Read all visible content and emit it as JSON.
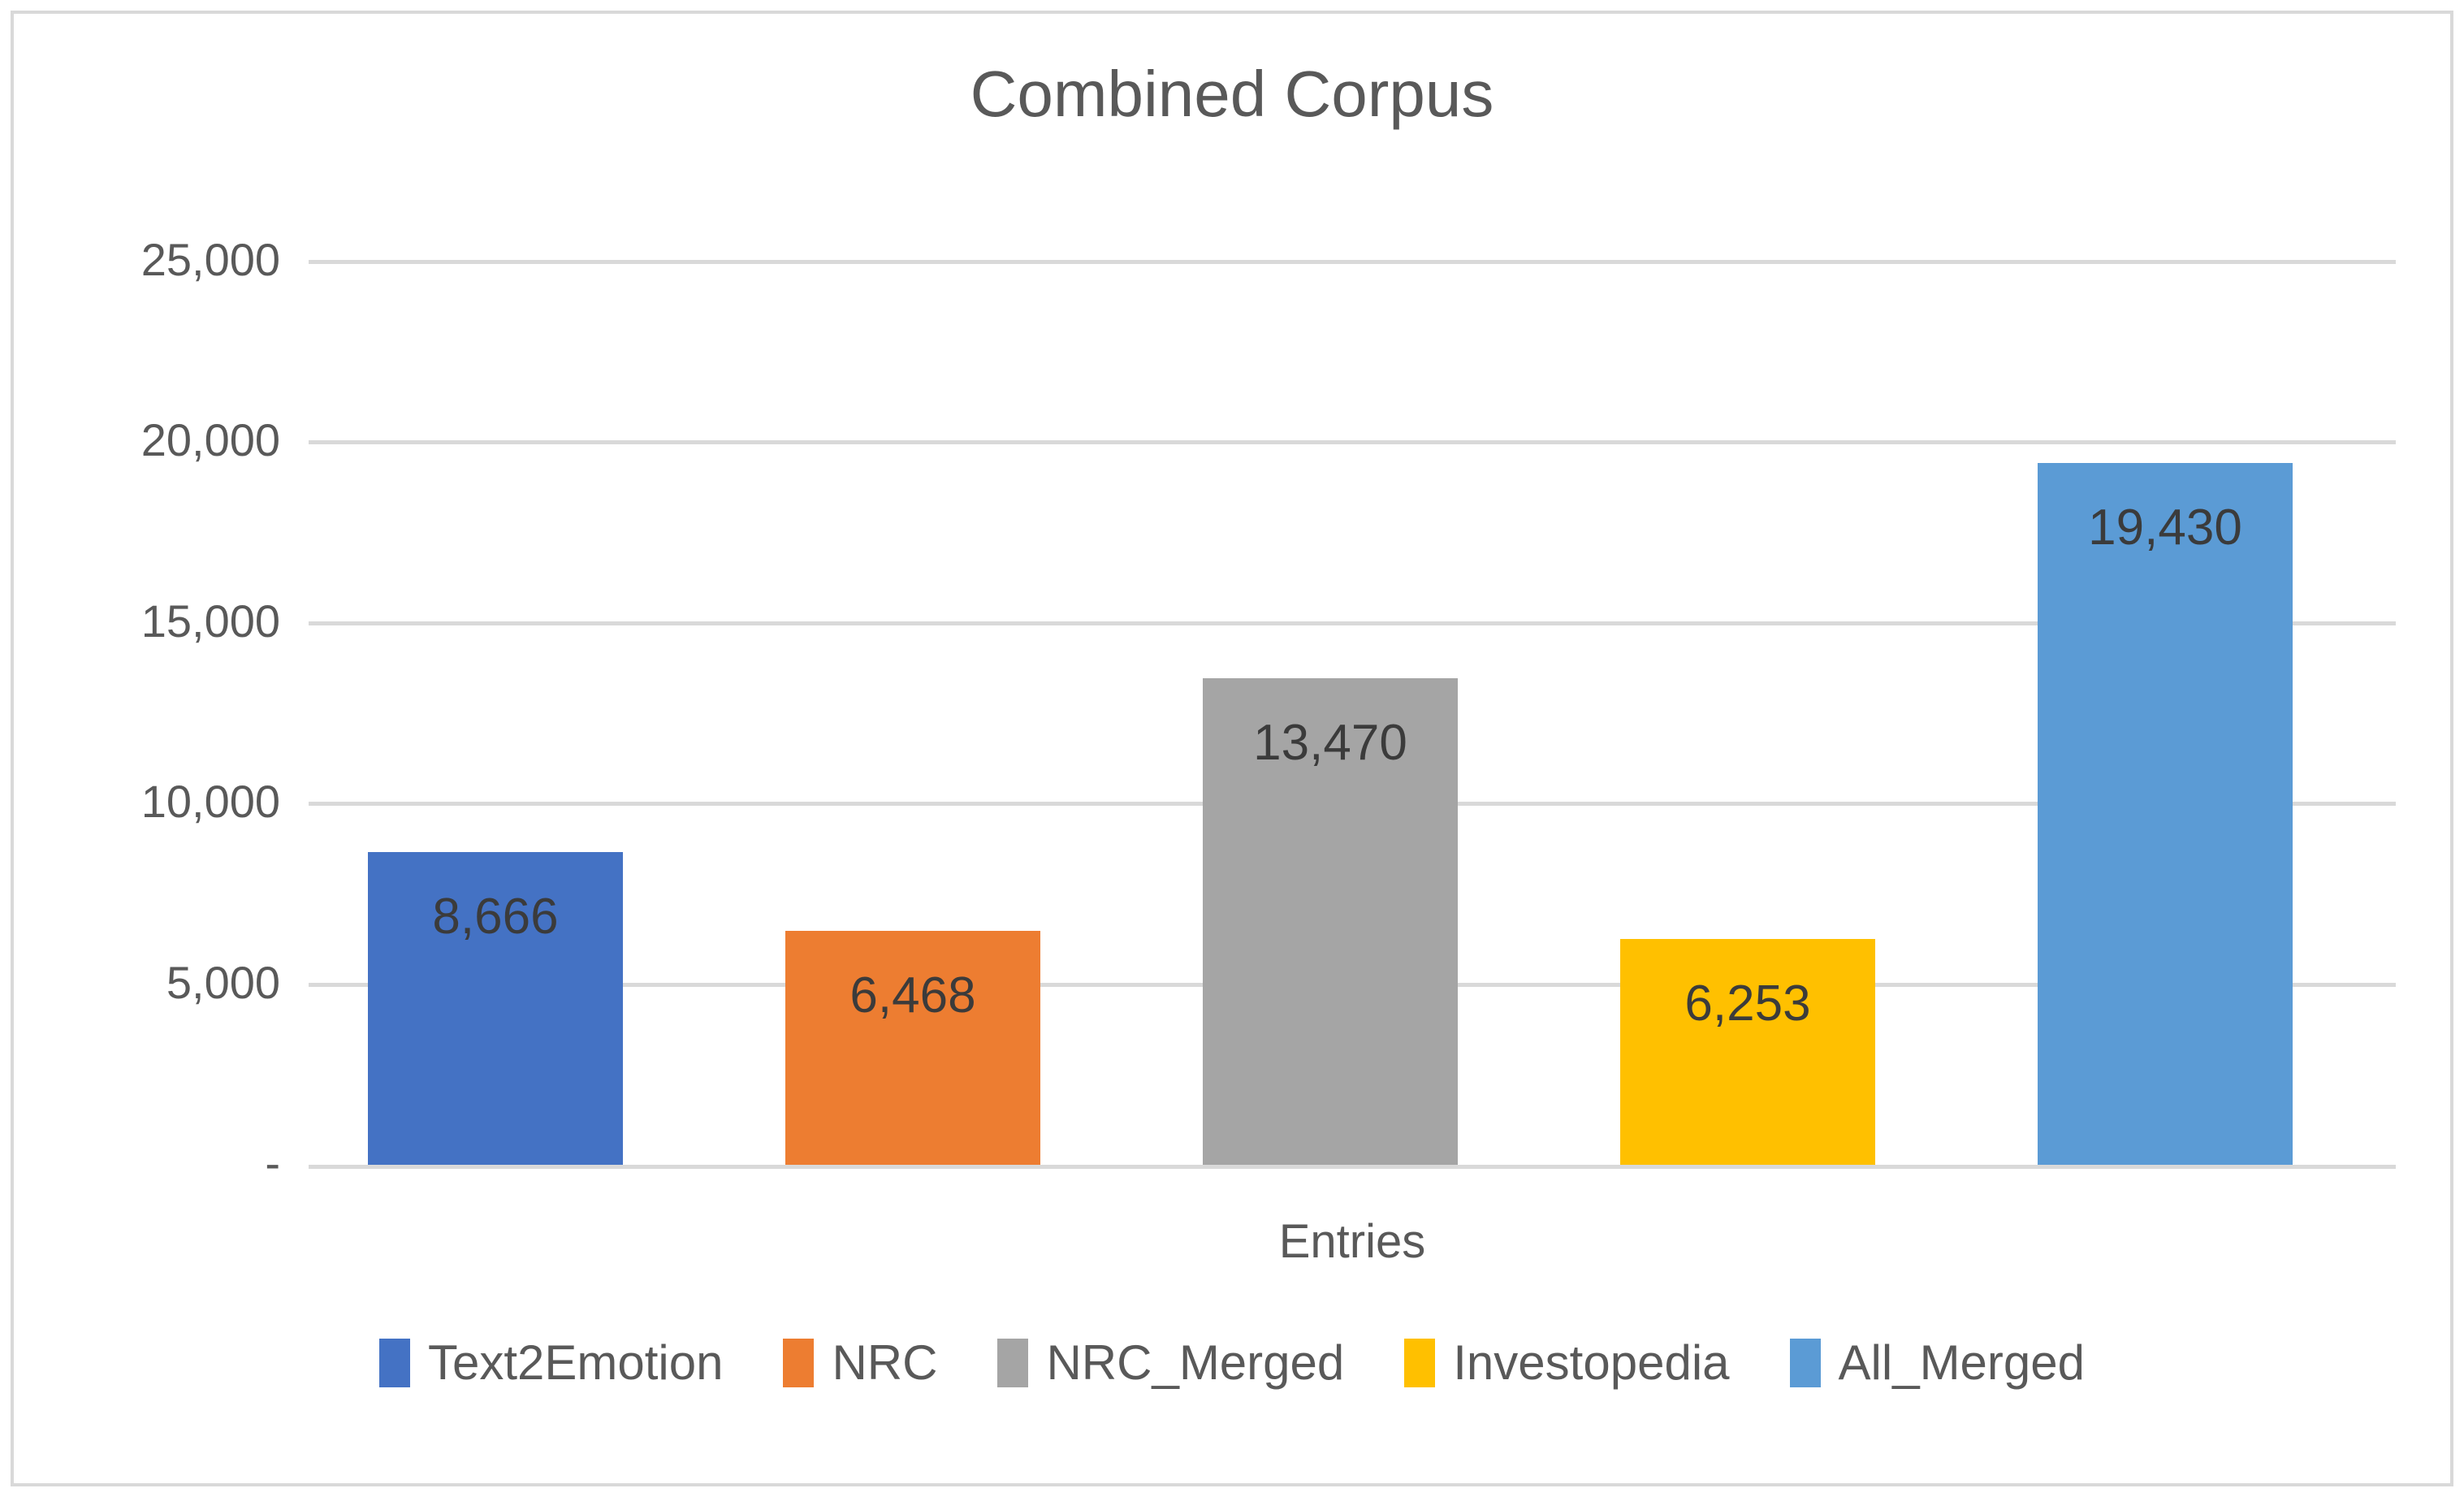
{
  "chart_data": {
    "type": "bar",
    "title": "Combined Corpus",
    "xlabel": "Entries",
    "ylabel": "",
    "categories": [
      "Text2Emotion",
      "NRC",
      "NRC_Merged",
      "Investopedia",
      "All_Merged"
    ],
    "values": [
      8666,
      6468,
      13470,
      6253,
      19430
    ],
    "value_labels": [
      "8,666",
      "6,468",
      "13,470",
      "6,253",
      "19,430"
    ],
    "colors": [
      "#4472C4",
      "#ED7D31",
      "#A5A5A5",
      "#FFC000",
      "#5B9BD5"
    ],
    "ylim": [
      0,
      25000
    ],
    "ytick_values": [
      25000,
      20000,
      15000,
      10000,
      5000,
      0
    ],
    "ytick_labels": [
      "25,000",
      "20,000",
      "15,000",
      "10,000",
      "5,000",
      " -   "
    ],
    "grid": true,
    "legend_position": "bottom",
    "legend": [
      {
        "label": "Text2Emotion",
        "color": "#4472C4"
      },
      {
        "label": "NRC",
        "color": "#ED7D31"
      },
      {
        "label": "NRC_Merged",
        "color": "#A5A5A5"
      },
      {
        "label": "Investopedia",
        "color": "#FFC000"
      },
      {
        "label": "All_Merged",
        "color": "#5B9BD5"
      }
    ]
  },
  "chart": {
    "title": "Combined Corpus",
    "x_axis_title": "Entries",
    "border_color": "#d9d9d9",
    "gridline_color": "#d9d9d9",
    "text_color": "#595959",
    "background": "#ffffff"
  },
  "y_axis": {
    "ticks": [
      {
        "label": "25,000",
        "value": 25000
      },
      {
        "label": "20,000",
        "value": 20000
      },
      {
        "label": "15,000",
        "value": 15000
      },
      {
        "label": "10,000",
        "value": 10000
      },
      {
        "label": "5,000",
        "value": 5000
      },
      {
        "label": " -   ",
        "value": 0
      }
    ]
  },
  "series": [
    {
      "name": "Text2Emotion",
      "value": 8666,
      "label": "8,666",
      "color": "#4472C4"
    },
    {
      "name": "NRC",
      "value": 6468,
      "label": "6,468",
      "color": "#ED7D31"
    },
    {
      "name": "NRC_Merged",
      "value": 13470,
      "label": "13,470",
      "color": "#A5A5A5"
    },
    {
      "name": "Investopedia",
      "value": 6253,
      "label": "6,253",
      "color": "#FFC000"
    },
    {
      "name": "All_Merged",
      "value": 19430,
      "label": "19,430",
      "color": "#5B9BD5"
    }
  ]
}
